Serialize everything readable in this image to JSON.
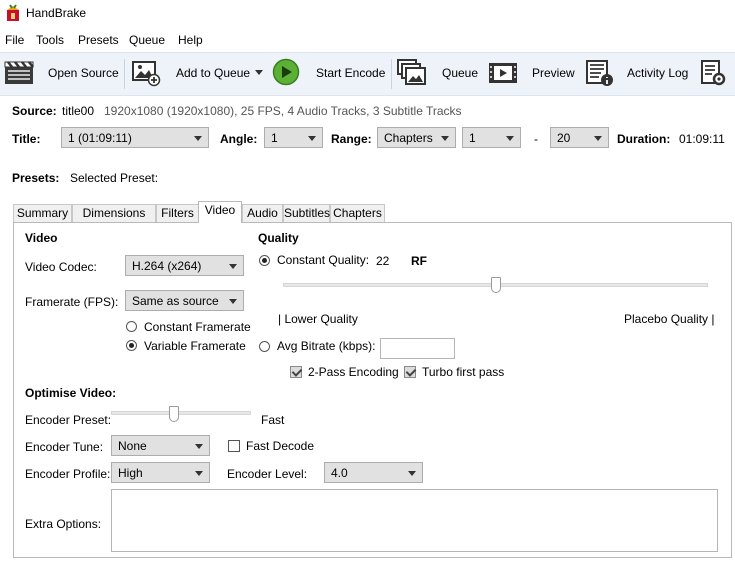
{
  "window": {
    "title": "HandBrake"
  },
  "menu": [
    "File",
    "Tools",
    "Presets",
    "Queue",
    "Help"
  ],
  "toolbar": {
    "open_source": "Open Source",
    "add_to_queue": "Add to Queue",
    "start_encode": "Start Encode",
    "queue": "Queue",
    "preview": "Preview",
    "activity_log": "Activity Log"
  },
  "source": {
    "label": "Source:",
    "name": "title00",
    "info": "1920x1080 (1920x1080), 25 FPS, 4 Audio Tracks, 3 Subtitle Tracks"
  },
  "title_row": {
    "title_label": "Title:",
    "title_value": "1 (01:09:11)",
    "angle_label": "Angle:",
    "angle_value": "1",
    "range_label": "Range:",
    "range_type": "Chapters",
    "range_start": "1",
    "range_sep": "-",
    "range_end": "20",
    "duration_label": "Duration:",
    "duration_value": "01:09:11"
  },
  "presets": {
    "label": "Presets:",
    "selected": "Selected Preset:"
  },
  "tabs": [
    "Summary",
    "Dimensions",
    "Filters",
    "Video",
    "Audio",
    "Subtitles",
    "Chapters"
  ],
  "video": {
    "section": "Video",
    "codec_label": "Video Codec:",
    "codec_value": "H.264 (x264)",
    "fps_label": "Framerate (FPS):",
    "fps_value": "Same as source",
    "constant_fr": "Constant Framerate",
    "variable_fr": "Variable Framerate"
  },
  "quality": {
    "section": "Quality",
    "cq_label": "Constant Quality:",
    "cq_value": "22",
    "cq_unit": "RF",
    "slider_fraction": 0.5,
    "low_label": "| Lower Quality",
    "high_label": "Placebo Quality |",
    "avg_label": "Avg Bitrate (kbps):",
    "avg_value": "",
    "two_pass": "2-Pass Encoding",
    "turbo": "Turbo first pass"
  },
  "optimise": {
    "section": "Optimise Video:",
    "preset_label": "Encoder Preset:",
    "preset_value": "Fast",
    "preset_fraction": 0.45,
    "tune_label": "Encoder Tune:",
    "tune_value": "None",
    "fast_decode": "Fast Decode",
    "profile_label": "Encoder Profile:",
    "profile_value": "High",
    "level_label": "Encoder Level:",
    "level_value": "4.0",
    "extra_label": "Extra Options:",
    "extra_value": ""
  }
}
